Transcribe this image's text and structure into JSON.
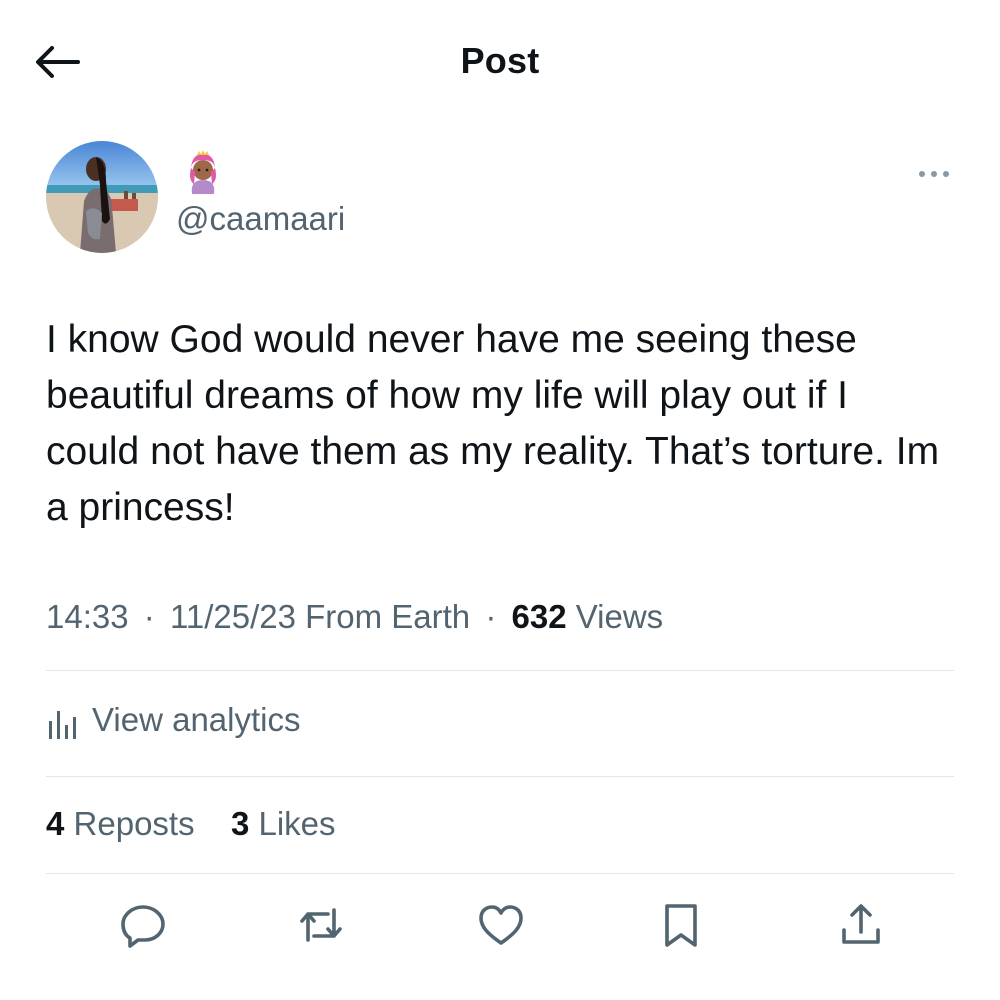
{
  "header": {
    "title": "Post"
  },
  "author": {
    "handle": "@caamaari",
    "avatar_icon": "profile-photo",
    "badge_icon": "princess-emoji"
  },
  "tweet": {
    "text": "I know God would never have me seeing these beautiful dreams of how my life will play out if I could not have them as my reality. That’s torture. Im a princess!"
  },
  "meta": {
    "time": "14:33",
    "date": "11/25/23",
    "source": "From Earth",
    "views_count": "632",
    "views_label": "Views",
    "separator": "·"
  },
  "analytics": {
    "label": "View analytics",
    "icon": "analytics-bars-icon"
  },
  "stats": {
    "reposts_count": "4",
    "reposts_label": "Reposts",
    "likes_count": "3",
    "likes_label": "Likes"
  },
  "actions": [
    "reply-icon",
    "repost-icon",
    "like-icon",
    "bookmark-icon",
    "share-icon"
  ],
  "colors": {
    "text_primary": "#0f1419",
    "text_secondary": "#536471",
    "divider": "#e2e6ea"
  }
}
